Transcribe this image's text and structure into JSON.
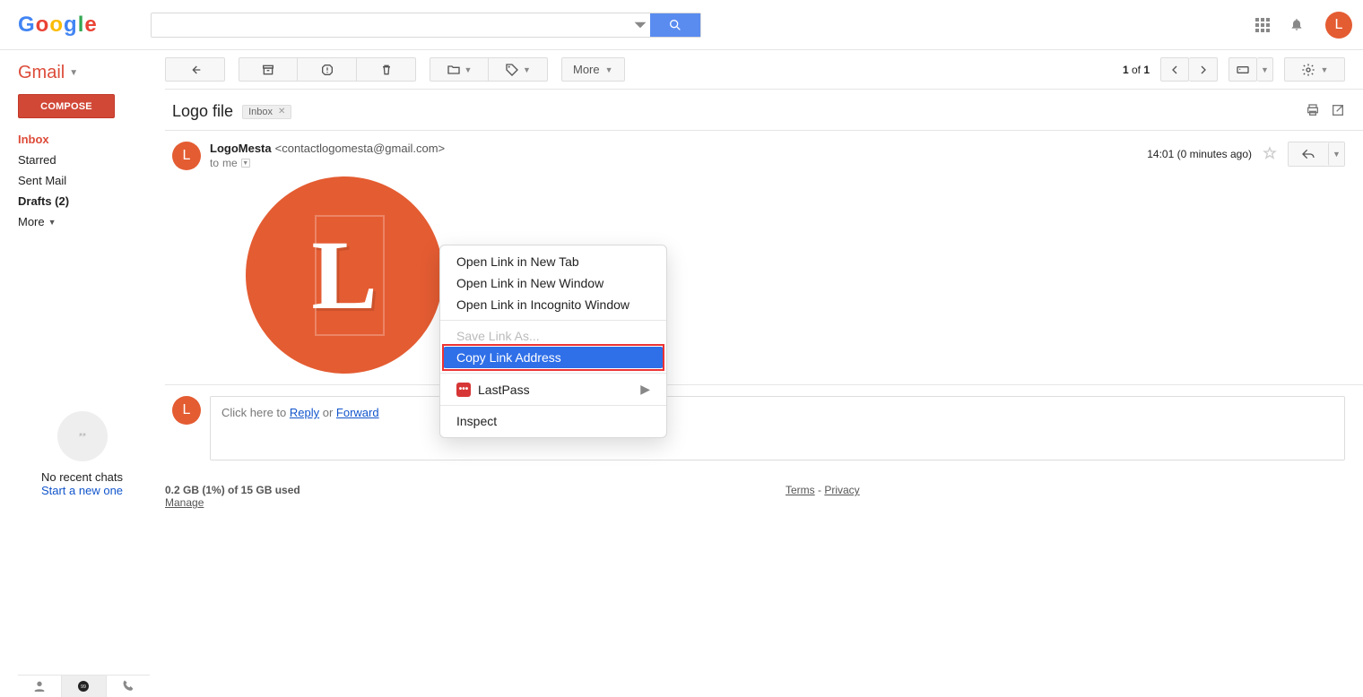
{
  "header": {
    "brand_letters": [
      "G",
      "o",
      "o",
      "g",
      "l",
      "e"
    ],
    "avatar_initial": "L"
  },
  "sidebar": {
    "gmail_label": "Gmail",
    "compose_label": "COMPOSE",
    "nav": {
      "inbox": "Inbox",
      "starred": "Starred",
      "sent": "Sent Mail",
      "drafts": "Drafts (2)",
      "more": "More"
    },
    "hangouts": {
      "no_chats": "No recent chats",
      "start_new": "Start a new one"
    }
  },
  "toolbar": {
    "more_label": "More",
    "counter_current": "1",
    "counter_of": " of ",
    "counter_total": "1"
  },
  "subject": {
    "title": "Logo file",
    "tag": "Inbox"
  },
  "message": {
    "from_name": "LogoMesta",
    "from_email": "<contactlogomesta@gmail.com>",
    "to_line_prefix": "to ",
    "to_recipient": "me",
    "timestamp": "14:01 (0 minutes ago)",
    "avatar_initial": "L",
    "logo_initial": "L"
  },
  "context_menu": {
    "open_tab": "Open Link in New Tab",
    "open_window": "Open Link in New Window",
    "open_incognito": "Open Link in Incognito Window",
    "save_as": "Save Link As...",
    "copy_link": "Copy Link Address",
    "lastpass": "LastPass",
    "lastpass_badge": "•••",
    "inspect": "Inspect"
  },
  "reply": {
    "avatar_initial": "L",
    "prefix": "Click here to ",
    "reply": "Reply",
    "or": " or ",
    "forward": "Forward"
  },
  "footer": {
    "usage": "0.2 GB (1%) of 15 GB used",
    "manage": "Manage",
    "terms": "Terms",
    "sep": " - ",
    "privacy": "Privacy"
  }
}
